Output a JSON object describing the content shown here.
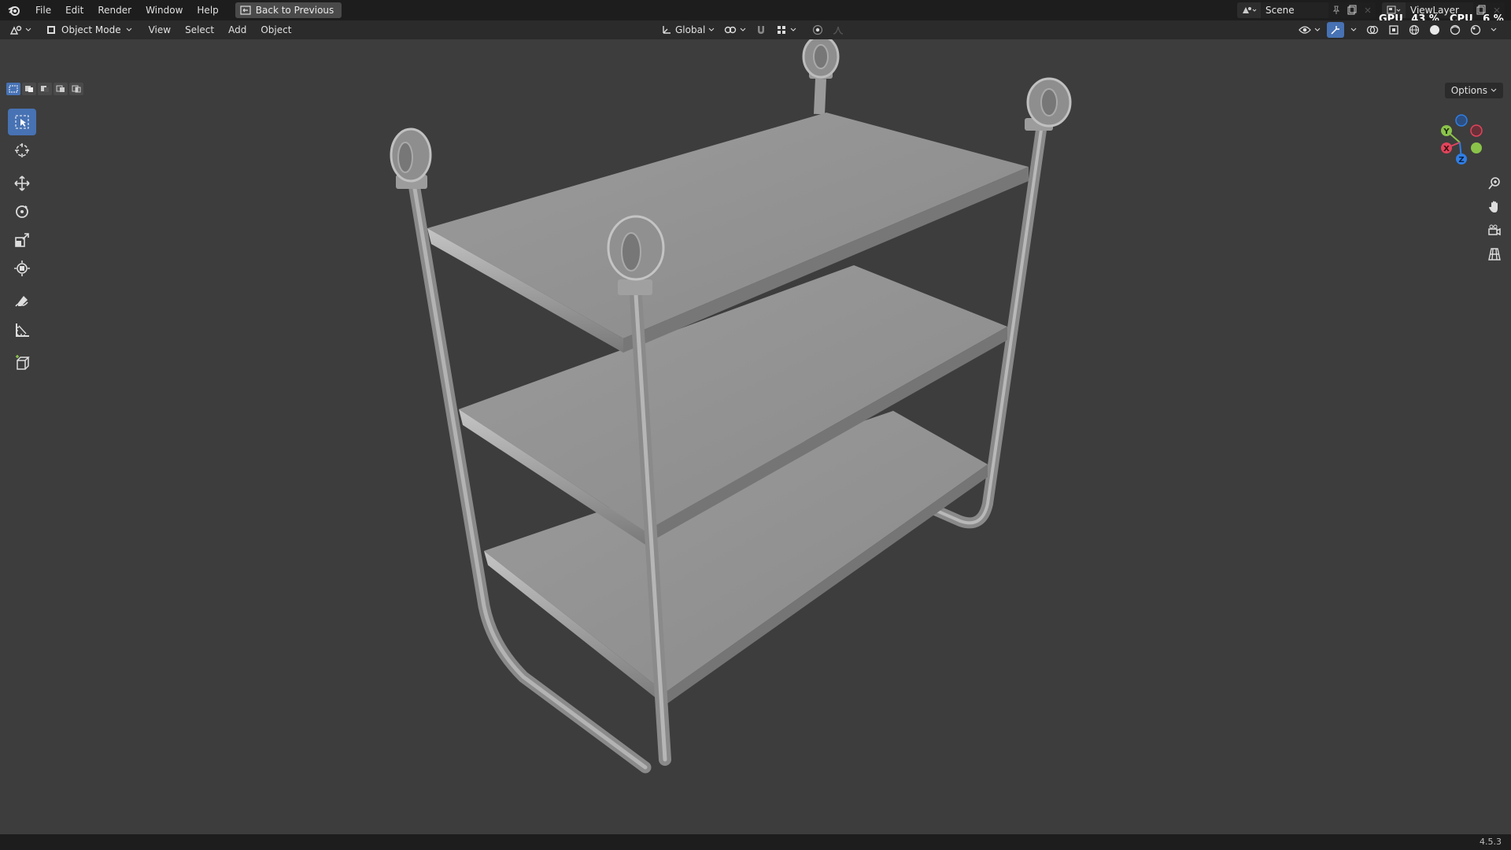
{
  "menubar": {
    "items": [
      "File",
      "Edit",
      "Render",
      "Window",
      "Help"
    ],
    "back_button": "Back to Previous"
  },
  "topright": {
    "scene": "Scene",
    "view_layer": "ViewLayer",
    "gpu_label": "GPU",
    "gpu_value": "43 %",
    "cpu_label": "CPU",
    "cpu_value": "6 %"
  },
  "header": {
    "mode": "Object Mode",
    "menus": [
      "View",
      "Select",
      "Add",
      "Object"
    ],
    "transform_orientation": "Global"
  },
  "viewport": {
    "options_label": "Options",
    "gizmo_axes": [
      "Y",
      "X",
      "Z"
    ]
  },
  "statusbar": {
    "version": "4.5.3"
  },
  "colors": {
    "accent": "#4772b3",
    "axis_x": "#e2445c",
    "axis_y": "#8bc34a",
    "axis_z": "#2f7ee6"
  }
}
